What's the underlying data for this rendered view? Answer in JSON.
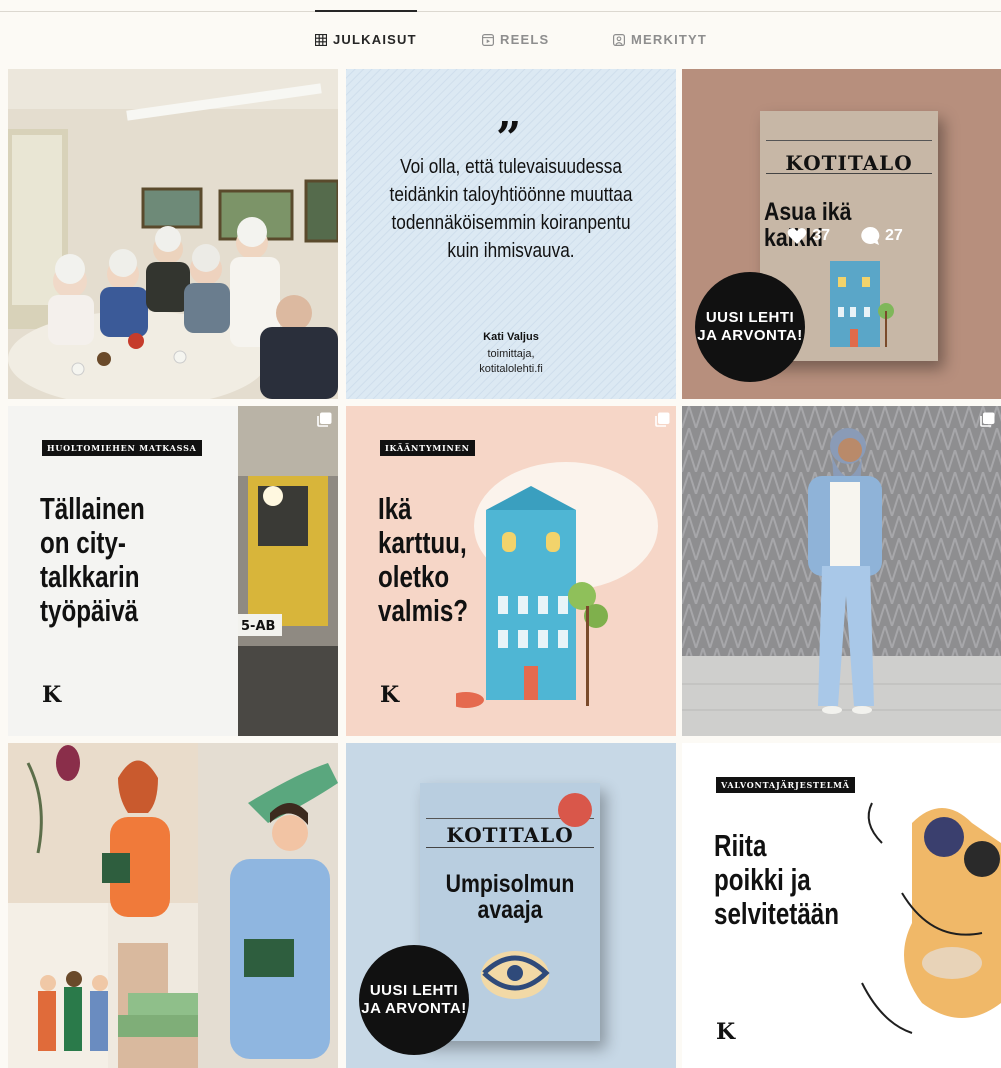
{
  "tabs": [
    {
      "label": "JULKAISUT",
      "icon": "grid-icon",
      "active": true
    },
    {
      "label": "REELS",
      "icon": "reels-icon",
      "active": false
    },
    {
      "label": "MERKITYT",
      "icon": "tagged-icon",
      "active": false
    }
  ],
  "posts": {
    "quote": {
      "text_lines": [
        "Voi olla, että tulevaisuudessa",
        "teidänkin taloyhtiöönne muuttaa",
        "todennäköisemmin koiranpentu",
        "kuin ihmisvauva."
      ],
      "author": "Kati Valjus",
      "role_line1": "toimittaja,",
      "role_line2": "kotitalolehti.fi"
    },
    "magazine1": {
      "masthead": "KOTITALO",
      "headline_line1": "Asua ikä",
      "headline_line2": "kaikki",
      "badge_line1": "UUSI LEHTI",
      "badge_line2": "JA ARVONTA!",
      "likes": "37",
      "comments": "27"
    },
    "talkkari": {
      "kicker": "HUOLTOMIEHEN MATKASSA",
      "line1": "Tällainen",
      "line2": "on city-",
      "line3": "talkkarin",
      "line4": "työpäivä",
      "logo": "K",
      "plate": "5-AB"
    },
    "ikaantyminen": {
      "kicker": "IKÄÄNTYMINEN",
      "line1": "Ikä",
      "line2": "karttuu,",
      "line3": "oletko",
      "line4": "valmis?",
      "logo": "K"
    },
    "magazine2": {
      "masthead": "KOTITALO",
      "headline_line1": "Umpisolmun",
      "headline_line2": "avaaja",
      "badge_line1": "UUSI LEHTI",
      "badge_line2": "JA ARVONTA!"
    },
    "riita": {
      "kicker": "VALVONTAJÄRJESTELMÄ",
      "line1": "Riita",
      "line2": "poikki ja",
      "line3": "selvitetään",
      "logo": "K"
    }
  },
  "colors": {
    "background": "#fcfaf5",
    "quote_bg": "#dce9f3",
    "magazine1_bg": "#b78f7d",
    "ikaantyminen_bg": "#f6d6c7",
    "magazine2_bg": "#c7d8e6",
    "badge": "#111111"
  }
}
